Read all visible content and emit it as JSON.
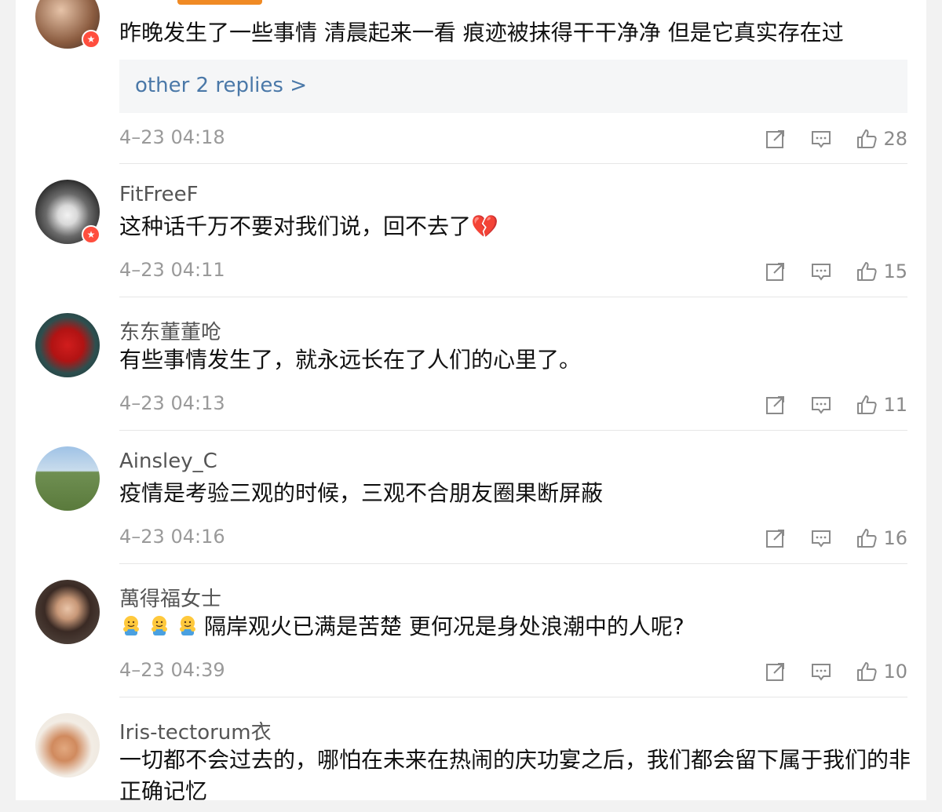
{
  "comments": [
    {
      "username": "",
      "text": "昨晚发生了一些事情 清晨起来一看 痕迹被抹得干干净净 但是它真实存在过",
      "replies_link": "other 2 replies >",
      "time": "4–23 04:18",
      "likes": "28",
      "badge": true
    },
    {
      "username": "FitFreeF",
      "text": "这种话千万不要对我们说，回不去了",
      "emoji": "💔",
      "time": "4–23 04:11",
      "likes": "15",
      "badge": true
    },
    {
      "username": "东东董董呛",
      "text": "有些事情发生了，就永远长在了人们的心里了。",
      "time": "4–23 04:13",
      "likes": "11"
    },
    {
      "username": "Ainsley_C",
      "text": "疫情是考验三观的时候，三观不合朋友圈果断屏蔽",
      "time": "4–23 04:16",
      "likes": "16"
    },
    {
      "username": "萬得福女士",
      "text": "隔岸观火已满是苦楚 更何况是身处浪潮中的人呢?",
      "time": "4–23 04:39",
      "likes": "10"
    },
    {
      "username": "Iris-tectorum衣",
      "text": "一切都不会过去的，哪怕在未来在热闹的庆功宴之后，我们都会留下属于我们的非正确记忆"
    }
  ],
  "colors": {
    "accent": "#f08a24",
    "link": "#4a78a8",
    "badge": "#ff4e3e",
    "meta": "#9a9a9a"
  },
  "icons": [
    "share-icon",
    "comment-icon",
    "thumbs-up-icon",
    "verified-badge-icon",
    "hug-emoji-icon"
  ]
}
